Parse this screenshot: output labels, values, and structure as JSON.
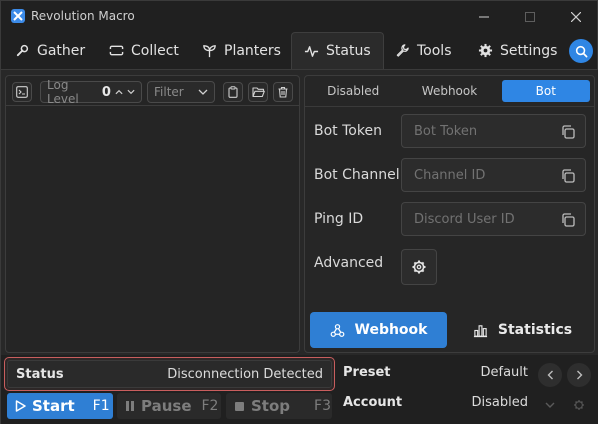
{
  "window": {
    "title": "Revolution Macro"
  },
  "tabs": [
    {
      "label": "Gather",
      "icon": "gather-icon",
      "active": false
    },
    {
      "label": "Collect",
      "icon": "ticket-icon",
      "active": false
    },
    {
      "label": "Planters",
      "icon": "sprout-icon",
      "active": false
    },
    {
      "label": "Status",
      "icon": "pulse-icon",
      "active": true
    },
    {
      "label": "Tools",
      "icon": "wrench-icon",
      "active": false
    },
    {
      "label": "Settings",
      "icon": "gear-icon",
      "active": false
    }
  ],
  "log": {
    "log_level_label": "Log Level",
    "log_level_value": "0",
    "filter_label": "Filter"
  },
  "discord": {
    "segments": [
      "Disabled",
      "Webhook",
      "Bot"
    ],
    "active_segment": "Bot",
    "fields": [
      {
        "label": "Bot Token",
        "placeholder": "Bot Token"
      },
      {
        "label": "Bot Channel",
        "placeholder": "Channel ID"
      },
      {
        "label": "Ping ID",
        "placeholder": "Discord User ID"
      }
    ],
    "advanced_label": "Advanced",
    "webhook_button": "Webhook",
    "statistics_button": "Statistics"
  },
  "status": {
    "label": "Status",
    "value": "Disconnection Detected"
  },
  "preset": {
    "label": "Preset",
    "value": "Default"
  },
  "account": {
    "label": "Account",
    "value": "Disabled"
  },
  "controls": {
    "start": {
      "label": "Start",
      "key": "F1"
    },
    "pause": {
      "label": "Pause",
      "key": "F2"
    },
    "stop": {
      "label": "Stop",
      "key": "F3"
    }
  },
  "colors": {
    "accent": "#2f86e4",
    "status_border": "#c95e5e"
  }
}
